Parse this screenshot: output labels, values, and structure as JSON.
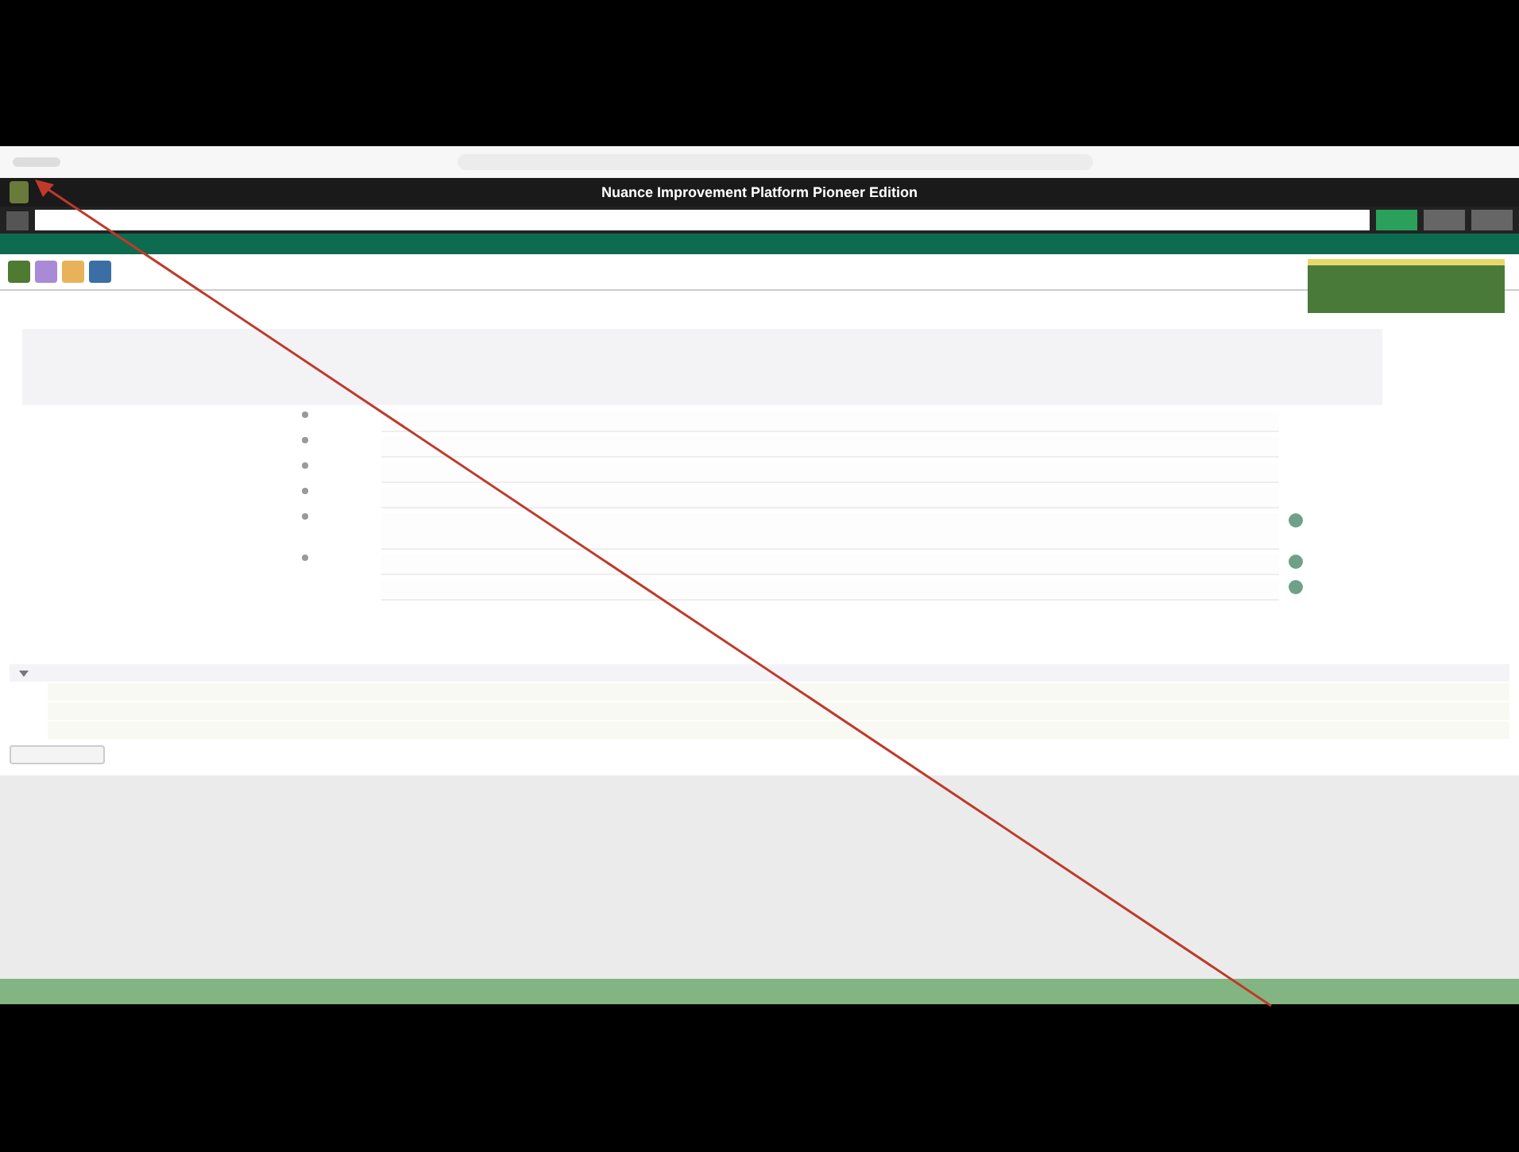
{
  "app_header": {
    "title": "Nuance Improvement Platform Pioneer Edition"
  },
  "toolbar": {
    "buttons": [
      {
        "color": "#4e7a32"
      },
      {
        "color": "#a98ad6"
      },
      {
        "color": "#e8b25a"
      },
      {
        "color": "#3a6ea5"
      }
    ]
  },
  "form": {
    "rows": [
      {
        "required": true,
        "multiline": false,
        "help": false
      },
      {
        "required": true,
        "multiline": false,
        "help": false
      },
      {
        "required": true,
        "multiline": false,
        "help": false
      },
      {
        "required": true,
        "multiline": false,
        "help": false
      },
      {
        "required": true,
        "multiline": true,
        "help": true
      },
      {
        "required": true,
        "multiline": false,
        "help": true
      },
      {
        "required": false,
        "multiline": false,
        "help": true
      }
    ]
  },
  "tree": {
    "items": [
      {
        "kind": "group",
        "expanded": true,
        "children": [
          {
            "kind": "leaf"
          },
          {
            "kind": "leaf"
          },
          {
            "kind": "leaf"
          }
        ]
      }
    ]
  },
  "annotation": {
    "kind": "arrow"
  }
}
